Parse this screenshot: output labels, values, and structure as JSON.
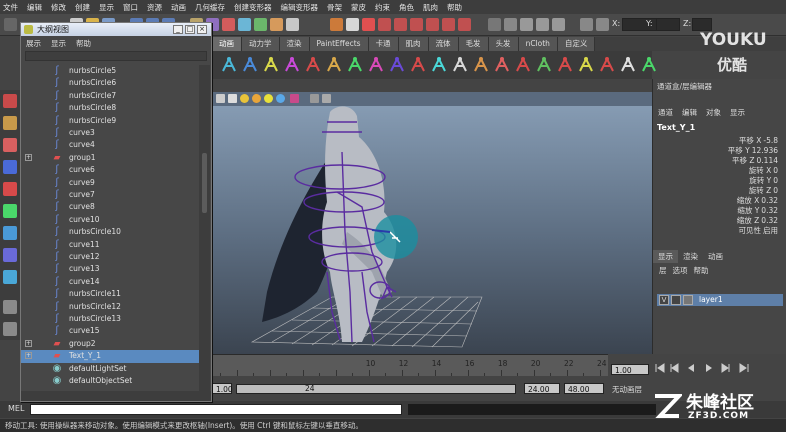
{
  "menubar": [
    "文件",
    "编辑",
    "修改",
    "创建",
    "显示",
    "窗口",
    "资源",
    "动画",
    "几何缓存",
    "创建变形器",
    "编辑变形器",
    "骨架",
    "蒙皮",
    "约束",
    "角色",
    "肌肉",
    "帮助"
  ],
  "status": {
    "x_label": "X:",
    "y_label": "Y:",
    "z_label": "Z:"
  },
  "shelf_tabs": [
    "动画",
    "动力学",
    "渲染",
    "PaintEffects",
    "卡通",
    "肌肉",
    "流体",
    "毛发",
    "头发",
    "nCloth",
    "自定义"
  ],
  "shelf_active_tab": "动画",
  "outliner": {
    "title": "大纲视图",
    "menu": [
      "展示",
      "显示",
      "帮助"
    ],
    "items": [
      {
        "label": "nurbsCircle5",
        "type": "curve"
      },
      {
        "label": "nurbsCircle6",
        "type": "curve"
      },
      {
        "label": "nurbsCircle7",
        "type": "curve"
      },
      {
        "label": "nurbsCircle8",
        "type": "curve"
      },
      {
        "label": "nurbsCircle9",
        "type": "curve"
      },
      {
        "label": "curve3",
        "type": "curve"
      },
      {
        "label": "curve4",
        "type": "curve"
      },
      {
        "label": "group1",
        "type": "group"
      },
      {
        "label": "curve6",
        "type": "curve"
      },
      {
        "label": "curve9",
        "type": "curve"
      },
      {
        "label": "curve7",
        "type": "curve"
      },
      {
        "label": "curve8",
        "type": "curve"
      },
      {
        "label": "curve10",
        "type": "curve"
      },
      {
        "label": "nurbsCircle10",
        "type": "curve"
      },
      {
        "label": "curve11",
        "type": "curve"
      },
      {
        "label": "curve12",
        "type": "curve"
      },
      {
        "label": "curve13",
        "type": "curve"
      },
      {
        "label": "curve14",
        "type": "curve"
      },
      {
        "label": "nurbsCircle11",
        "type": "curve"
      },
      {
        "label": "nurbsCircle12",
        "type": "curve"
      },
      {
        "label": "nurbsCircle13",
        "type": "curve"
      },
      {
        "label": "curve15",
        "type": "curve"
      },
      {
        "label": "group2",
        "type": "group"
      },
      {
        "label": "Text_Y_1",
        "type": "group",
        "selected": true
      },
      {
        "label": "defaultLightSet",
        "type": "set"
      },
      {
        "label": "defaultObjectSet",
        "type": "set"
      }
    ]
  },
  "channel_box": {
    "header": "通道盒/层编辑器",
    "menu": [
      "通道",
      "编辑",
      "对象",
      "显示"
    ],
    "node": "Text_Y_1",
    "attributes": [
      {
        "name": "平移 X",
        "value": "-5.8"
      },
      {
        "name": "平移 Y",
        "value": "12.936"
      },
      {
        "name": "平移 Z",
        "value": "0.114"
      },
      {
        "name": "旋转 X",
        "value": "0"
      },
      {
        "name": "旋转 Y",
        "value": "0"
      },
      {
        "name": "旋转 Z",
        "value": "0"
      },
      {
        "name": "缩放 X",
        "value": "0.32"
      },
      {
        "name": "缩放 Y",
        "value": "0.32"
      },
      {
        "name": "缩放 Z",
        "value": "0.32"
      },
      {
        "name": "可见性",
        "value": "启用"
      }
    ]
  },
  "layer_editor": {
    "tabs": [
      "显示",
      "渲染",
      "动画"
    ],
    "menu": [
      "层",
      "选项",
      "帮助"
    ],
    "layer_v": "V",
    "layer_name": "layer1"
  },
  "timeline": {
    "ticks": [
      "10",
      "12",
      "14",
      "16",
      "18",
      "20",
      "22",
      "24"
    ],
    "current_frame": "1.00"
  },
  "range": {
    "start": "1.00",
    "range_end": "24",
    "end": "24.00",
    "max": "48.00",
    "char_set": "无动画层"
  },
  "command": {
    "label": "MEL"
  },
  "help_line": "移动工具: 使用操纵器来移动对象。使用编辑模式来更改枢轴(Insert)。使用 Ctrl 键和鼠标左键以垂直移动。",
  "watermark": {
    "youku": "YOUKU",
    "youku_cn": "优酷",
    "zf_cn": "朱峰社区",
    "zf_en": "ZF3D.COM"
  },
  "colors": {
    "viewport_top": "#8aa0b8",
    "selection": "#5a8ac0",
    "rig": "#5a2ca0"
  }
}
